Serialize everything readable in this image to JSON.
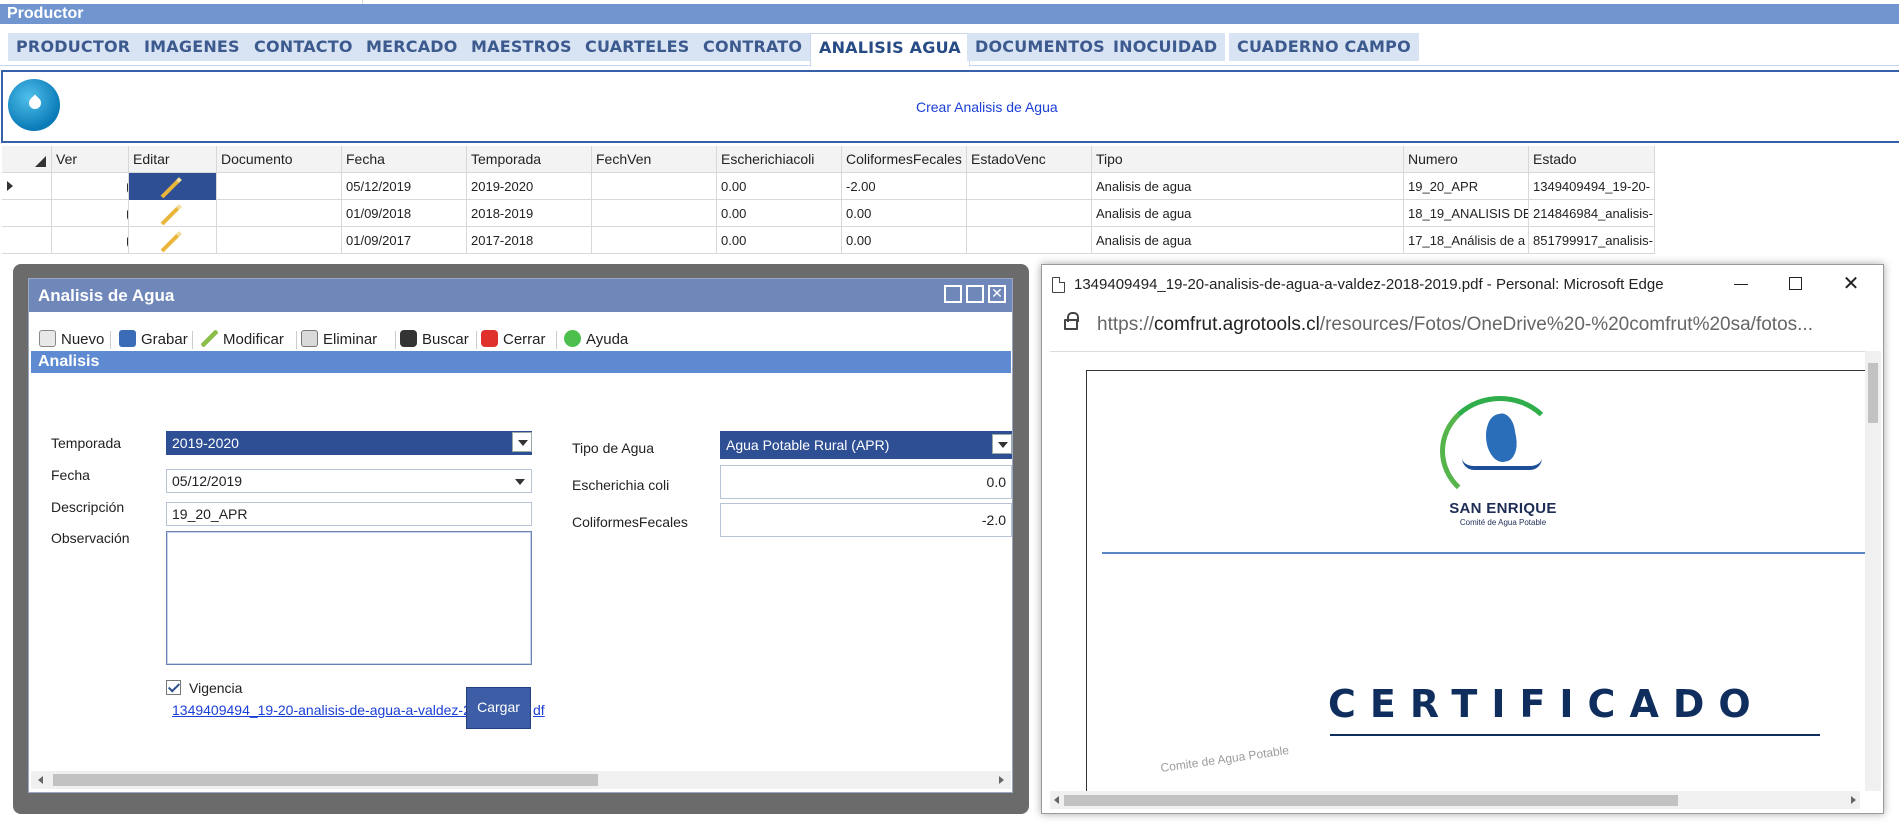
{
  "app": {
    "title": "Productor"
  },
  "tabs": [
    {
      "label": "PRODUCTOR"
    },
    {
      "label": "IMAGENES"
    },
    {
      "label": "CONTACTO"
    },
    {
      "label": "MERCADO"
    },
    {
      "label": "MAESTROS"
    },
    {
      "label": "CUARTELES"
    },
    {
      "label": "CONTRATO"
    },
    {
      "label": "ANALISIS AGUA",
      "active": true
    },
    {
      "label": "DOCUMENTOS"
    },
    {
      "label": "INOCUIDAD"
    },
    {
      "label": "CUADERNO CAMPO"
    }
  ],
  "action_panel": {
    "icon": "water-drop-icon",
    "create_link": "Crear Analisis de Agua"
  },
  "grid": {
    "columns": [
      "Ver",
      "Editar",
      "Documento",
      "Fecha",
      "Temporada",
      "FechVen",
      "Escherichiacoli",
      "ColiformesFecales",
      "EstadoVenc",
      "Tipo",
      "Numero",
      "Estado"
    ],
    "rows": [
      {
        "fecha": "05/12/2019",
        "temporada": "2019-2020",
        "fechven": "",
        "escherichia": "0.00",
        "coliformes": "-2.00",
        "estadovenc": "",
        "tipo": "Analisis de agua",
        "numero": "19_20_APR",
        "estado": "1349409494_19-20-",
        "selected": true
      },
      {
        "fecha": "01/09/2018",
        "temporada": "2018-2019",
        "fechven": "",
        "escherichia": "0.00",
        "coliformes": "0.00",
        "estadovenc": "",
        "tipo": "Analisis de agua",
        "numero": "18_19_ANALISIS DE",
        "estado": "214846984_analisis-"
      },
      {
        "fecha": "01/09/2017",
        "temporada": "2017-2018",
        "fechven": "",
        "escherichia": "0.00",
        "coliformes": "0.00",
        "estadovenc": "",
        "tipo": "Analisis de agua",
        "numero": "17_18_Análisis de a",
        "estado": "851799917_analisis-"
      }
    ]
  },
  "dialog": {
    "title": "Analisis de Agua",
    "toolbar": {
      "nuevo": "Nuevo",
      "grabar": "Grabar",
      "modificar": "Modificar",
      "eliminar": "Eliminar",
      "buscar": "Buscar",
      "cerrar": "Cerrar",
      "ayuda": "Ayuda"
    },
    "section": "Analisis",
    "form": {
      "temporada_label": "Temporada",
      "temporada_value": "2019-2020",
      "fecha_label": "Fecha",
      "fecha_value": "05/12/2019",
      "descripcion_label": "Descripción",
      "descripcion_value": "19_20_APR",
      "observacion_label": "Observación",
      "tipo_agua_label": "Tipo de Agua",
      "tipo_agua_value": "Agua Potable Rural (APR)",
      "escherichia_label": "Escherichia coli",
      "escherichia_value": "0.0",
      "coliformes_label": "ColiformesFecales",
      "coliformes_value": "-2.0",
      "vigencia_label": "Vigencia",
      "vigencia_checked": true,
      "file_link": "1349409494_19-20-analisis-de-agua-a-valdez-20",
      "file_link_tail": "df",
      "cargar_label": "Cargar"
    }
  },
  "edge": {
    "title": "1349409494_19-20-analisis-de-agua-a-valdez-2018-2019.pdf - Personal: Microsoft Edge",
    "url_prefix": "https://",
    "url_domain": "comfrut.agrotools.cl",
    "url_path": "/resources/Fotos/OneDrive%20-%20comfrut%20sa/fotos...",
    "pdf": {
      "logo_name": "SAN ENRIQUE",
      "logo_sub": "Comité de Agua Potable",
      "heading": "CERTIFICADO",
      "stamp": "Comite de Agua Potable"
    }
  }
}
